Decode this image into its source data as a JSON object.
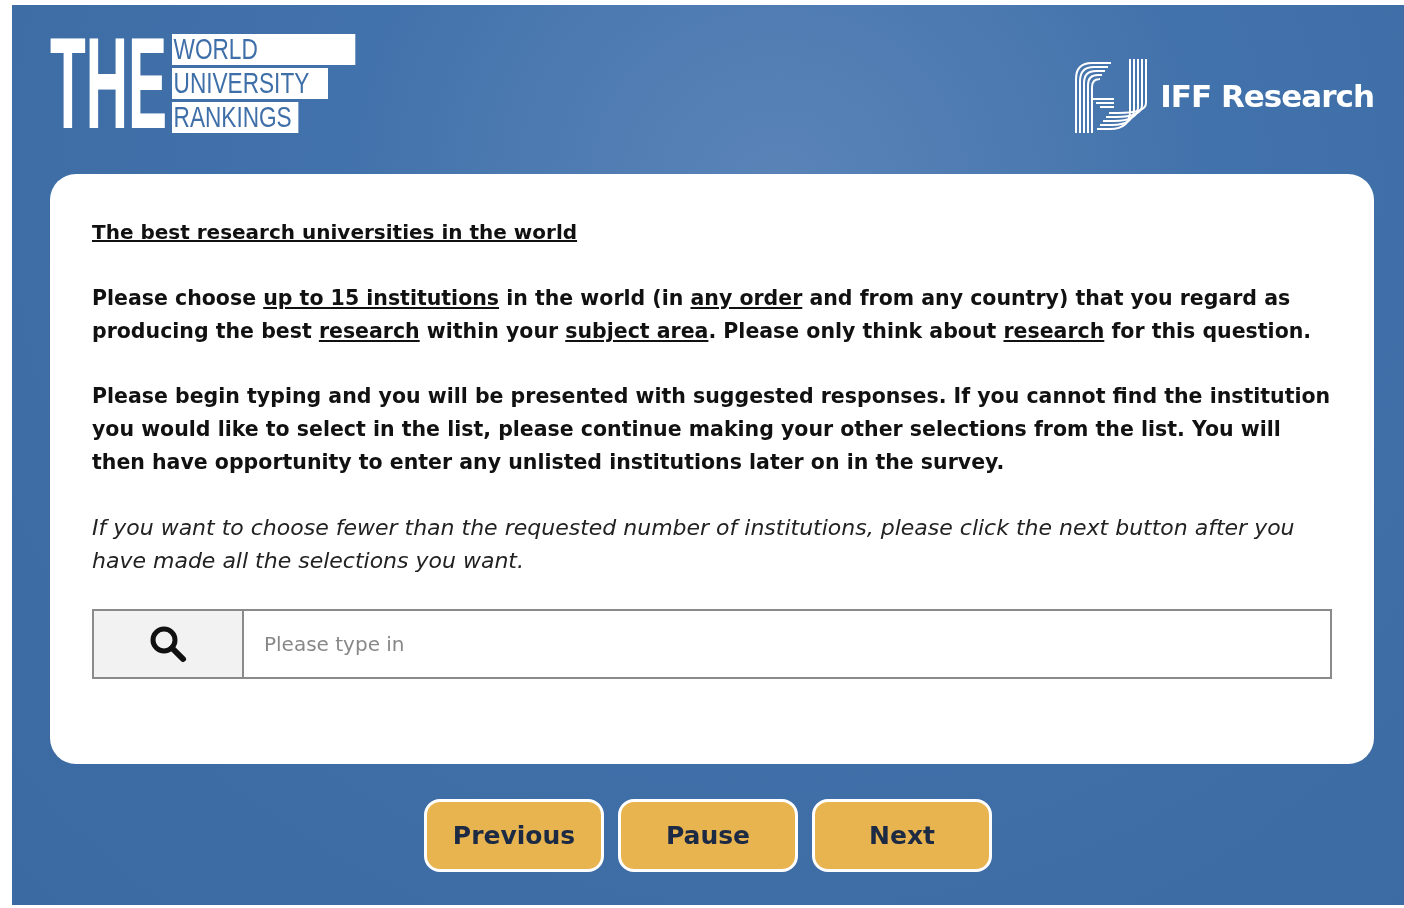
{
  "logo": {
    "mark": "THE",
    "lines": [
      "WORLD",
      "UNIVERSITY",
      "RANKINGS"
    ]
  },
  "partner_logo": {
    "name": "IFF Research"
  },
  "question": {
    "title": "The best research universities in the world",
    "paragraphs": [
      {
        "kind": "instruction",
        "segments": [
          {
            "text": "Please choose ",
            "underlined": false
          },
          {
            "text": "up to 15 institutions",
            "underlined": true
          },
          {
            "text": " in the world (in ",
            "underlined": false
          },
          {
            "text": "any order",
            "underlined": true
          },
          {
            "text": " and from any country) that you regard as producing the best ",
            "underlined": false
          },
          {
            "text": "research",
            "underlined": true
          },
          {
            "text": " within your ",
            "underlined": false
          },
          {
            "text": "subject area",
            "underlined": true
          },
          {
            "text": ". Please only think about ",
            "underlined": false
          },
          {
            "text": "research",
            "underlined": true
          },
          {
            "text": " for this question.",
            "underlined": false
          }
        ]
      },
      {
        "kind": "instruction",
        "segments": [
          {
            "text": "Please begin typing and you will be presented with suggested responses. If you cannot find the institution you would like to select in the list, please continue making your other selections from the list. You will then have opportunity to enter any unlisted institutions later on in the survey.",
            "underlined": false
          }
        ]
      },
      {
        "kind": "note",
        "segments": [
          {
            "text": "If you want to choose fewer than the requested number of institutions, please click the next button after you have made all the selections you want.",
            "underlined": false
          }
        ]
      }
    ],
    "search": {
      "placeholder": "Please type in"
    }
  },
  "buttons": [
    "Previous",
    "Pause",
    "Next"
  ]
}
